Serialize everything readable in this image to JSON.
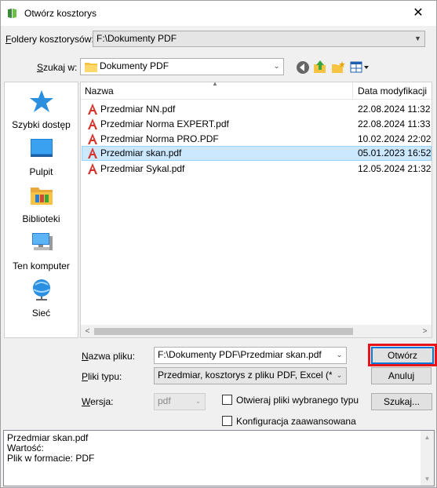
{
  "window": {
    "title": "Otwórz kosztorys",
    "close_glyph": "✕"
  },
  "folder": {
    "label_prefix": "F",
    "label_rest": "oldery kosztorysów:",
    "value": "F:\\Dokumenty PDF"
  },
  "lookin": {
    "label_prefix": "S",
    "label_rest": "zukaj w:",
    "value": "Dokumenty PDF"
  },
  "toolbar": {
    "icons": [
      "back-icon",
      "up-folder-icon",
      "new-folder-icon",
      "view-menu-icon"
    ]
  },
  "places": [
    {
      "label": "Szybki dostęp",
      "icon": "star-icon"
    },
    {
      "label": "Pulpit",
      "icon": "desktop-icon"
    },
    {
      "label": "Biblioteki",
      "icon": "libraries-icon"
    },
    {
      "label": "Ten komputer",
      "icon": "computer-icon"
    },
    {
      "label": "Sieć",
      "icon": "network-icon"
    }
  ],
  "filelist": {
    "columns": {
      "name": "Nazwa",
      "date": "Data modyfikacji"
    },
    "files": [
      {
        "name": "Przedmiar NN.pdf",
        "date": "22.08.2024 11:32"
      },
      {
        "name": "Przedmiar Norma EXPERT.pdf",
        "date": "22.08.2024 11:33"
      },
      {
        "name": "Przedmiar Norma PRO.PDF",
        "date": "10.02.2024 22:02"
      },
      {
        "name": "Przedmiar skan.pdf",
        "date": "05.01.2023 16:52"
      },
      {
        "name": "Przedmiar Sykal.pdf",
        "date": "12.05.2024 21:32"
      }
    ],
    "selected_index": 3
  },
  "filename": {
    "label_prefix": "N",
    "label_rest": "azwa pliku:",
    "value": "F:\\Dokumenty PDF\\Przedmiar skan.pdf"
  },
  "filetype": {
    "label_prefix": "P",
    "label_rest": "liki typu:",
    "value": "Przedmiar, kosztorys z pliku PDF, Excel (*.pdf;*.xlsx"
  },
  "version": {
    "label_prefix": "W",
    "label_rest": "ersja:",
    "value": "pdf"
  },
  "options": {
    "open_selected_type": "Otwieraj pliki wybranego typu",
    "advanced_config": "Konfiguracja zaawansowana"
  },
  "buttons": {
    "open": "Otwórz",
    "cancel": "Anuluj",
    "search_prefix": "Szuka",
    "search_mnemonic": "j",
    "search_suffix": "..."
  },
  "info": {
    "line1": "Przedmiar skan.pdf",
    "line2": "Wartość:",
    "line3": "Plik w formacie: PDF"
  },
  "colors": {
    "accent": "#0078d7",
    "highlight": "#e8141c",
    "selection": "#cce8ff"
  }
}
